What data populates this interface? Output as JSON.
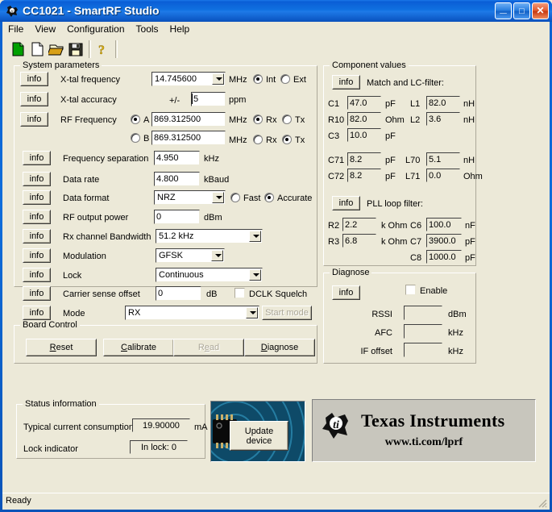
{
  "window": {
    "title_app": "CC1021",
    "title_sep": " - ",
    "title_suite": "SmartRF Studio",
    "app_icon": "ti-logo-icon",
    "buttons": {
      "minimize": "_",
      "maximize": "□",
      "close": "✕"
    }
  },
  "menu": {
    "items": [
      "File",
      "View",
      "Configuration",
      "Tools",
      "Help"
    ]
  },
  "toolbar": {
    "items": [
      {
        "name": "new-green-document-icon",
        "tip": "New"
      },
      {
        "name": "new-document-icon",
        "tip": "New blank"
      },
      {
        "name": "open-folder-icon",
        "tip": "Open"
      },
      {
        "name": "save-floppy-icon",
        "tip": "Save"
      },
      {
        "name": "help-question-icon",
        "tip": "Help"
      }
    ]
  },
  "system_parameters": {
    "legend": "System parameters",
    "info_label": "info",
    "rows": [
      {
        "label": "X-tal frequency",
        "value": "14.745600",
        "unit": "MHz"
      },
      {
        "label": "X-tal accuracy",
        "prefix": "+/-",
        "value": "5",
        "unit": "ppm"
      },
      {
        "label": "RF Frequency",
        "value": "869.312500",
        "unit": "MHz"
      },
      {
        "label": "",
        "value": "869.312500",
        "unit": "MHz"
      },
      {
        "label": "Frequency separation",
        "value": "4.950",
        "unit": "kHz"
      },
      {
        "label": "Data rate",
        "value": "4.800",
        "unit": "kBaud"
      },
      {
        "label": "Data format",
        "value": "NRZ",
        "unit": ""
      },
      {
        "label": "RF output power",
        "value": "0",
        "unit": "dBm"
      },
      {
        "label": "Rx channel Bandwidth",
        "value": "51.2 kHz",
        "unit": ""
      },
      {
        "label": "Modulation",
        "value": "GFSK",
        "unit": ""
      },
      {
        "label": "Lock",
        "value": "Continuous",
        "unit": ""
      },
      {
        "label": "Carrier sense offset",
        "value": "0",
        "unit": "dB"
      },
      {
        "label": "Mode",
        "value": "RX",
        "unit": ""
      }
    ],
    "xtal_source": {
      "int": "Int",
      "ext": "Ext",
      "selected": "Int"
    },
    "freq_a": {
      "letter": "A",
      "rx": "Rx",
      "tx": "Tx",
      "selected": "Rx"
    },
    "freq_b": {
      "letter": "B",
      "rx": "Rx",
      "tx": "Tx",
      "selected": "Tx"
    },
    "data_format_mode": {
      "fast": "Fast",
      "accurate": "Accurate",
      "selected": "Accurate"
    },
    "dclk_squelch": {
      "label": "DCLK Squelch",
      "checked": false
    },
    "start_mode_button": {
      "label": "Start mode",
      "enabled": false
    }
  },
  "board_control": {
    "legend": "Board Control",
    "buttons": [
      {
        "label": "Reset",
        "accel": "R",
        "enabled": true
      },
      {
        "label": "Calibrate",
        "accel": "C",
        "enabled": true
      },
      {
        "label": "Read",
        "accel": "e",
        "enabled": false
      },
      {
        "label": "Diagnose",
        "accel": "D",
        "enabled": true
      }
    ]
  },
  "component_values": {
    "legend": "Component values",
    "info_label": "info",
    "match_title": "Match and LC-filter:",
    "pll_title": "PLL loop filter:",
    "match_rows": [
      {
        "n1": "C1",
        "v1": "47.0",
        "u1": "pF",
        "n2": "L1",
        "v2": "82.0",
        "u2": "nH"
      },
      {
        "n1": "R10",
        "v1": "82.0",
        "u1": "Ohm",
        "n2": "L2",
        "v2": "3.6",
        "u2": "nH"
      },
      {
        "n1": "C3",
        "v1": "10.0",
        "u1": "pF",
        "n2": "",
        "v2": "",
        "u2": ""
      }
    ],
    "filter_rows": [
      {
        "n1": "C71",
        "v1": "8.2",
        "u1": "pF",
        "n2": "L70",
        "v2": "5.1",
        "u2": "nH"
      },
      {
        "n1": "C72",
        "v1": "8.2",
        "u1": "pF",
        "n2": "L71",
        "v2": "0.0",
        "u2": "Ohm"
      }
    ],
    "pll_rows": [
      {
        "n1": "R2",
        "v1": "2.2",
        "u1": "k Ohm",
        "n2": "C6",
        "v2": "100.0",
        "u2": "nF"
      },
      {
        "n1": "R3",
        "v1": "6.8",
        "u1": "k Ohm",
        "n2": "C7",
        "v2": "3900.0",
        "u2": "pF"
      },
      {
        "n1": "",
        "v1": "",
        "u1": "",
        "n2": "C8",
        "v2": "1000.0",
        "u2": "pF"
      }
    ]
  },
  "diagnose": {
    "legend": "Diagnose",
    "info_label": "info",
    "enable": {
      "label": "Enable",
      "checked": false
    },
    "rows": [
      {
        "label": "RSSI",
        "value": "",
        "unit": "dBm"
      },
      {
        "label": "AFC",
        "value": "",
        "unit": "kHz"
      },
      {
        "label": "IF offset",
        "value": "",
        "unit": "kHz"
      }
    ]
  },
  "status_information": {
    "legend": "Status information",
    "current_label": "Typical current consumption",
    "current_value": "19.90000",
    "current_unit": "mA",
    "lock_label": "Lock indicator",
    "lock_value": "In lock: 0"
  },
  "update_device": {
    "line1": "Update",
    "line2": "device"
  },
  "branding": {
    "company": "Texas Instruments",
    "url": "www.ti.com/lprf"
  },
  "statusbar": {
    "text": "Ready"
  },
  "colors": {
    "face": "#ece9d8",
    "title_blue": "#0a5ed6",
    "close_red": "#c73a12",
    "chip_teal": "#0d4f6e",
    "ti_gray": "#c8c6bd"
  }
}
